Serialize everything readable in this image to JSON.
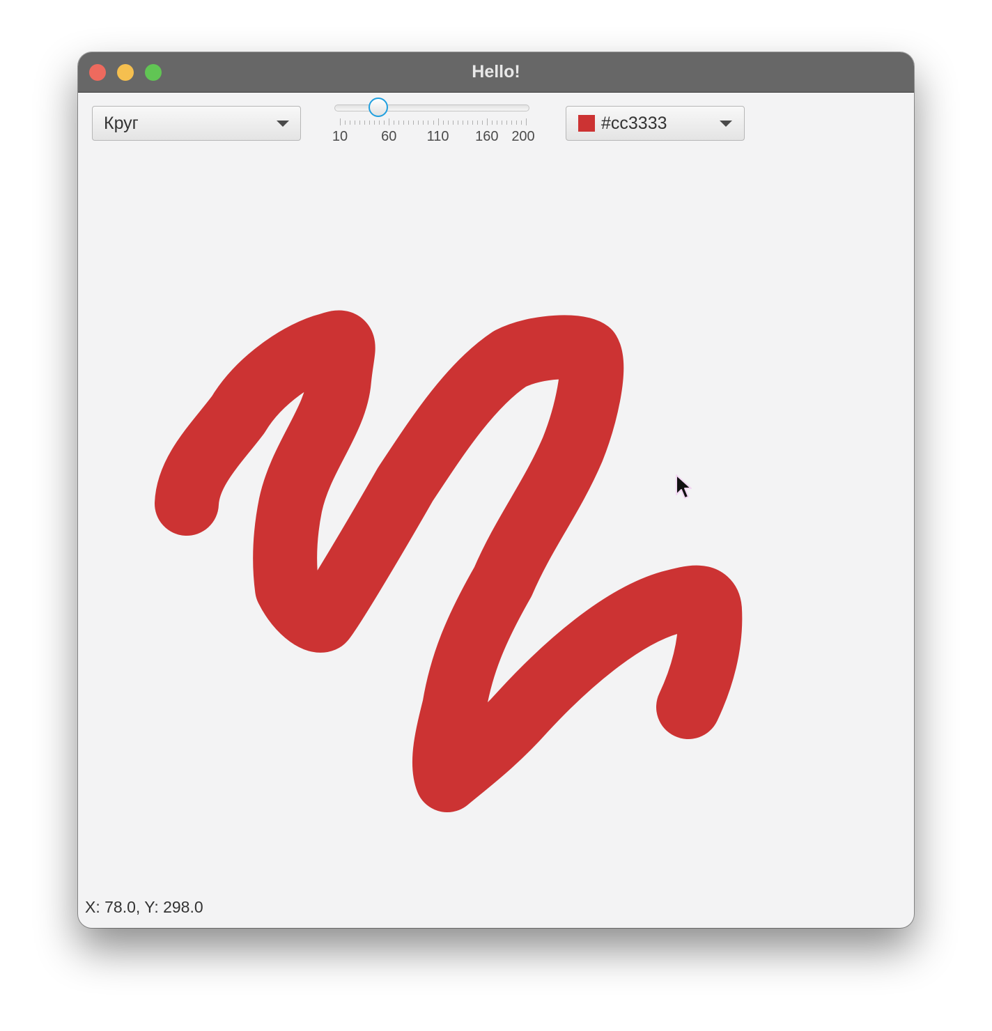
{
  "window": {
    "title": "Hello!",
    "controls": [
      "close",
      "minimize",
      "maximize"
    ]
  },
  "toolbar": {
    "shape_select": {
      "value": "Круг",
      "icon": "chevron-down-icon"
    },
    "size_slider": {
      "min": 10,
      "max": 200,
      "value": 50,
      "tick_labels": [
        "10",
        "60",
        "110",
        "160",
        "200"
      ]
    },
    "color_picker": {
      "value": "#cc3333",
      "swatch_color": "#cc3333",
      "icon": "chevron-down-icon"
    }
  },
  "canvas": {
    "stroke_color": "#cc3333"
  },
  "status": {
    "coordinates": "X: 78.0, Y: 298.0"
  }
}
